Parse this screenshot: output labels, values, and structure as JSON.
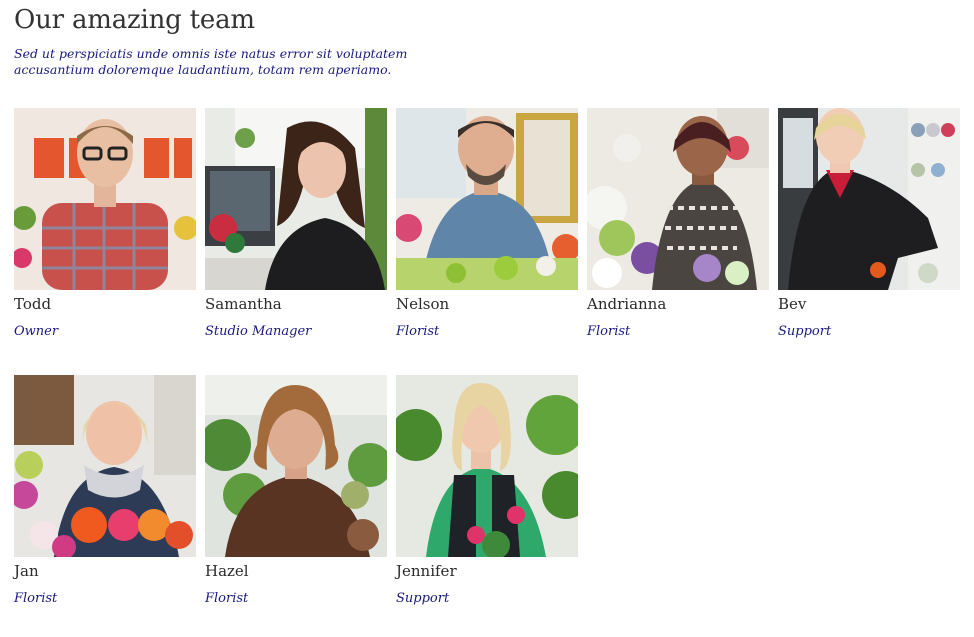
{
  "page": {
    "title": "Our amazing team",
    "intro": "Sed ut perspiciatis unde omnis iste natus error sit voluptatem accusantium doloremque laudantium, totam rem aperiamo."
  },
  "team": [
    {
      "name": "Todd",
      "role": "Owner"
    },
    {
      "name": "Samantha",
      "role": "Studio Manager"
    },
    {
      "name": "Nelson",
      "role": "Florist"
    },
    {
      "name": "Andrianna",
      "role": "Florist"
    },
    {
      "name": "Bev",
      "role": "Support"
    },
    {
      "name": "Jan",
      "role": "Florist"
    },
    {
      "name": "Hazel",
      "role": "Florist"
    },
    {
      "name": "Jennifer",
      "role": "Support"
    }
  ],
  "colors": {
    "heading": "#333333",
    "accent_text": "#1a1a80",
    "background": "#ffffff"
  }
}
